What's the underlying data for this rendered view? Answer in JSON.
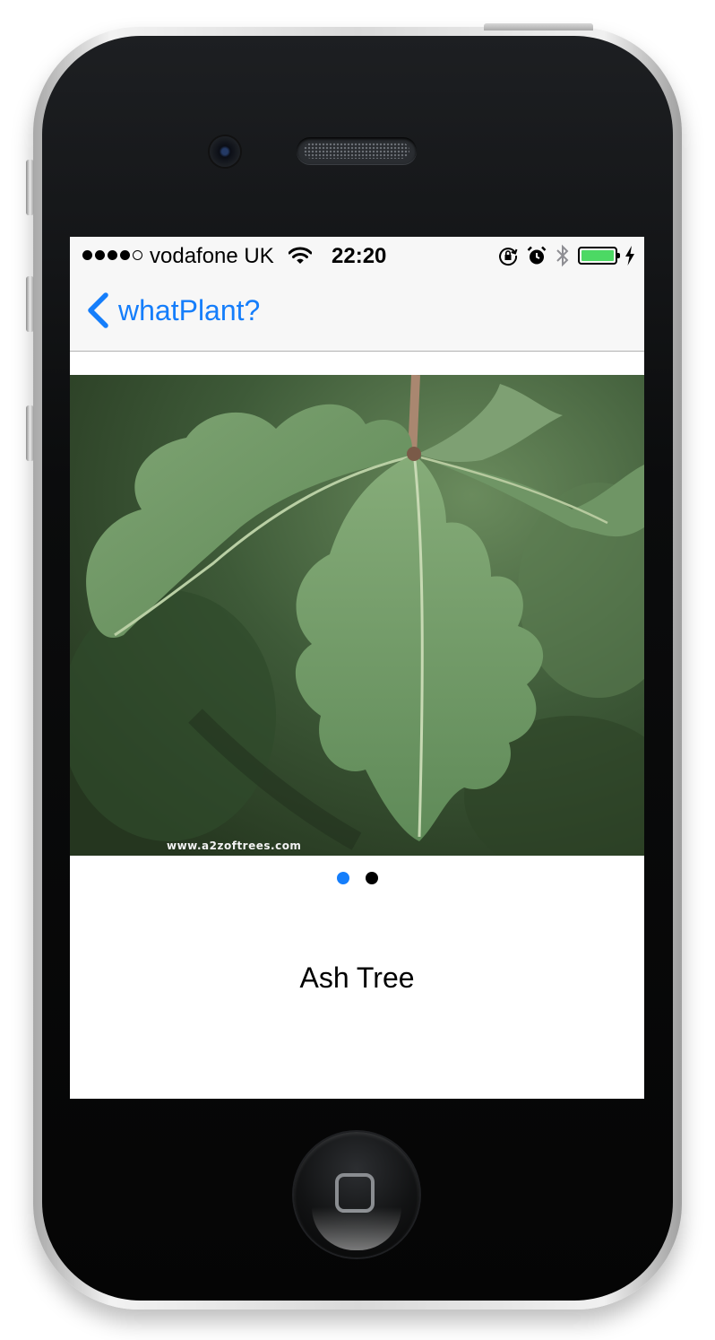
{
  "status_bar": {
    "carrier": "vodafone UK",
    "time": "22:20",
    "signal_bars_filled": 4,
    "signal_bars_total": 5,
    "battery_level": 1.0
  },
  "nav": {
    "back_label": "whatPlant?"
  },
  "photo": {
    "watermark": "www.a2zoftrees.com"
  },
  "pager": {
    "page_count": 2,
    "current_page": 1,
    "active_color": "#157efb",
    "inactive_color": "#000000"
  },
  "plant": {
    "name": "Ash Tree"
  },
  "colors": {
    "accent": "#157efb",
    "battery": "#4cd964"
  }
}
